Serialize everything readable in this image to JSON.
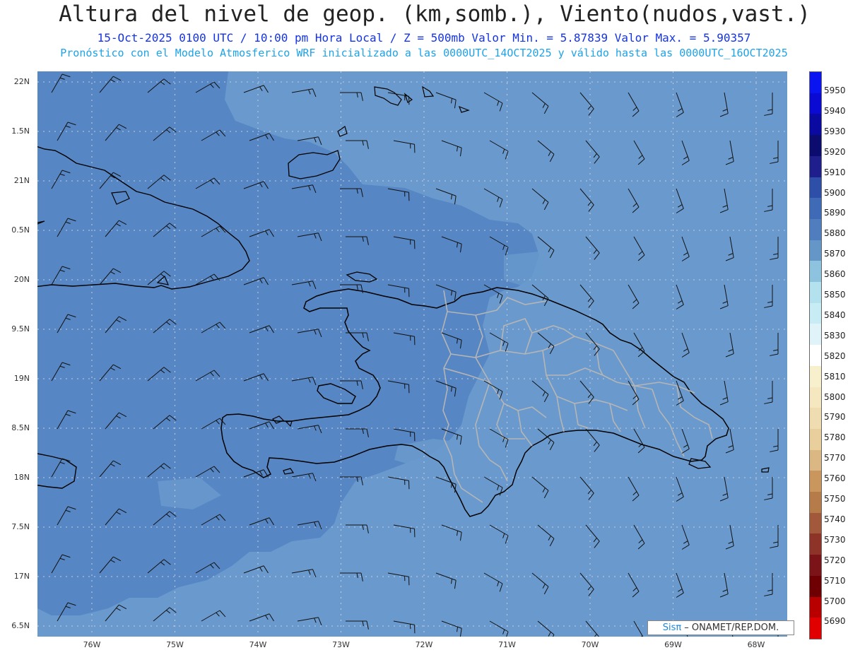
{
  "title": "Altura del nivel de geop. (km,somb.), Viento(nudos,vast.)",
  "subtitle": "15-Oct-2025  0100 UTC / 10:00 pm Hora Local / Z = 500mb    Valor Min. = 5.87839   Valor Max. = 5.90357",
  "model_line": "Pronóstico con el Modelo Atmosferico WRF inicializado a las 0000UTC_14OCT2025 y válido hasta las  0000UTC_16OCT2025",
  "lat_labels": [
    "22N",
    "1.5N",
    "21N",
    "0.5N",
    "20N",
    "9.5N",
    "19N",
    "8.5N",
    "18N",
    "7.5N",
    "17N",
    "6.5N"
  ],
  "lon_labels": [
    "76W",
    "75W",
    "74W",
    "73W",
    "72W",
    "71W",
    "70W",
    "69W",
    "68W"
  ],
  "colorbar": {
    "labels": [
      "5950",
      "5940",
      "5930",
      "5920",
      "5910",
      "5900",
      "5890",
      "5880",
      "5870",
      "5860",
      "5850",
      "5840",
      "5830",
      "5820",
      "5810",
      "5800",
      "5790",
      "5780",
      "5770",
      "5760",
      "5750",
      "5740",
      "5730",
      "5720",
      "5710",
      "5700",
      "5690"
    ],
    "colors": [
      "#0a14f0",
      "#0a0ad2",
      "#0a0aa0",
      "#0c0c6e",
      "#1e1e8c",
      "#2e4fa8",
      "#3f6ab5",
      "#4f7dbe",
      "#6496c8",
      "#8ec3e0",
      "#b4e1ee",
      "#c8ecf4",
      "#dff3f8",
      "#ffffff",
      "#f8efcc",
      "#f5e7c0",
      "#efdcb0",
      "#e8cf9c",
      "#dbb883",
      "#c9975e",
      "#b57c4a",
      "#a2583a",
      "#8d3328",
      "#7a1418",
      "#6e0004",
      "#b80000",
      "#e00000"
    ]
  },
  "credit": {
    "brand": "Sisπ",
    "text": "– ONAMET/REP.DOM."
  },
  "colors": {
    "field_high": "#5686c3",
    "field_low": "#6a9acd",
    "land_border": "#000000",
    "admin_border": "#b5b5b5",
    "gridline": "#c0c8d8"
  }
}
